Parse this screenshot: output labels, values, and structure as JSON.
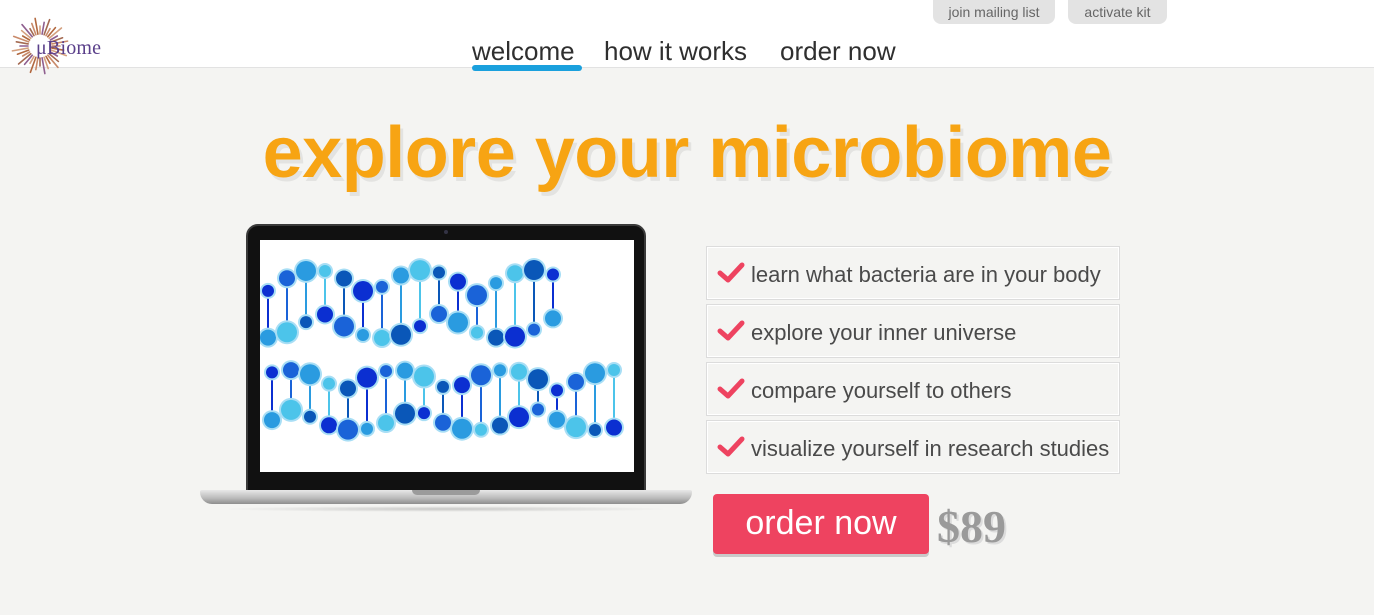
{
  "brand": {
    "logo_text": "μBiome",
    "logo_icon": "bacteria-burst-icon"
  },
  "top_links": {
    "mailing": "join mailing list",
    "activate": "activate kit"
  },
  "nav": {
    "items": [
      "welcome",
      "how it works",
      "order now"
    ],
    "active": "welcome"
  },
  "hero": {
    "title": "explore your microbiome"
  },
  "features": {
    "icon": "checkmark-icon",
    "items": [
      "learn what bacteria are in your body",
      "explore your inner universe",
      "compare yourself to others",
      "visualize yourself in research studies"
    ]
  },
  "cta": {
    "order_label": "order now",
    "price": "$89"
  },
  "colors": {
    "hero_orange": "#f7a413",
    "accent_pink": "#ee4360",
    "nav_blue": "#1aa0dd",
    "price_gray": "#9a9a9a",
    "dna_blues": [
      "#0b2fd1",
      "#1a63d8",
      "#2a9be0",
      "#4cc4ea",
      "#0a57b8"
    ]
  }
}
